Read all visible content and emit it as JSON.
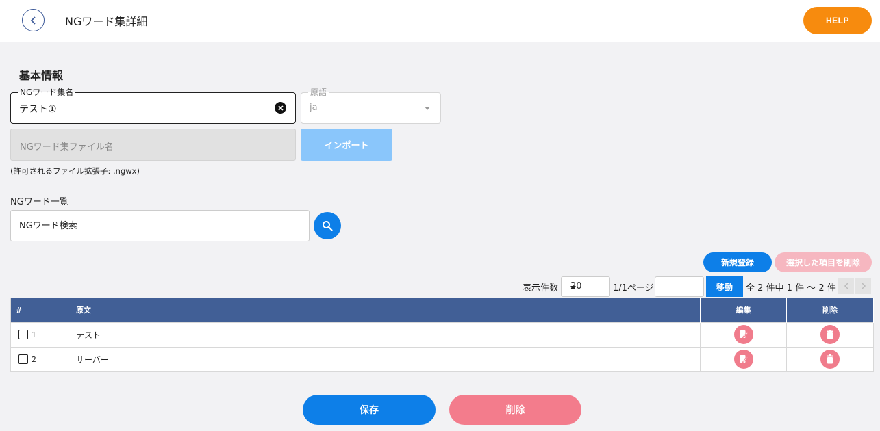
{
  "header": {
    "title": "NGワード集詳細",
    "help_label": "HELP"
  },
  "basic": {
    "section_title": "基本情報",
    "name_label": "NGワード集名",
    "name_value": "テスト①",
    "lang_label": "原語",
    "lang_value": "ja",
    "file_placeholder": "NGワード集ファイル名",
    "import_label": "インポート",
    "hint": "(許可されるファイル拡張子: .ngwx)"
  },
  "list": {
    "title": "NGワード一覧",
    "search_placeholder": "NGワード検索",
    "new_label": "新規登録",
    "delete_selected_label": "選択した項目を削除"
  },
  "pager": {
    "per_page_label": "表示件数",
    "per_page_value": "20",
    "page_info": "1/1ページ",
    "go_label": "移動",
    "count_info": "全 2 件中 1 件 ～ 2 件"
  },
  "table": {
    "headers": [
      "#",
      "原文",
      "編集",
      "削除"
    ],
    "rows": [
      {
        "num": "1",
        "text": "テスト"
      },
      {
        "num": "2",
        "text": "サーバー"
      }
    ]
  },
  "footer": {
    "save_label": "保存",
    "delete_label": "削除"
  },
  "colors": {
    "primary": "#0d7fe8",
    "help": "#f78b0e",
    "danger": "#f37c8c",
    "table_header": "#415f96"
  },
  "icons": {
    "back": "chevron-left-icon",
    "clear": "close-circle-icon",
    "search": "search-icon",
    "edit": "edit-icon",
    "delete": "trash-icon"
  }
}
